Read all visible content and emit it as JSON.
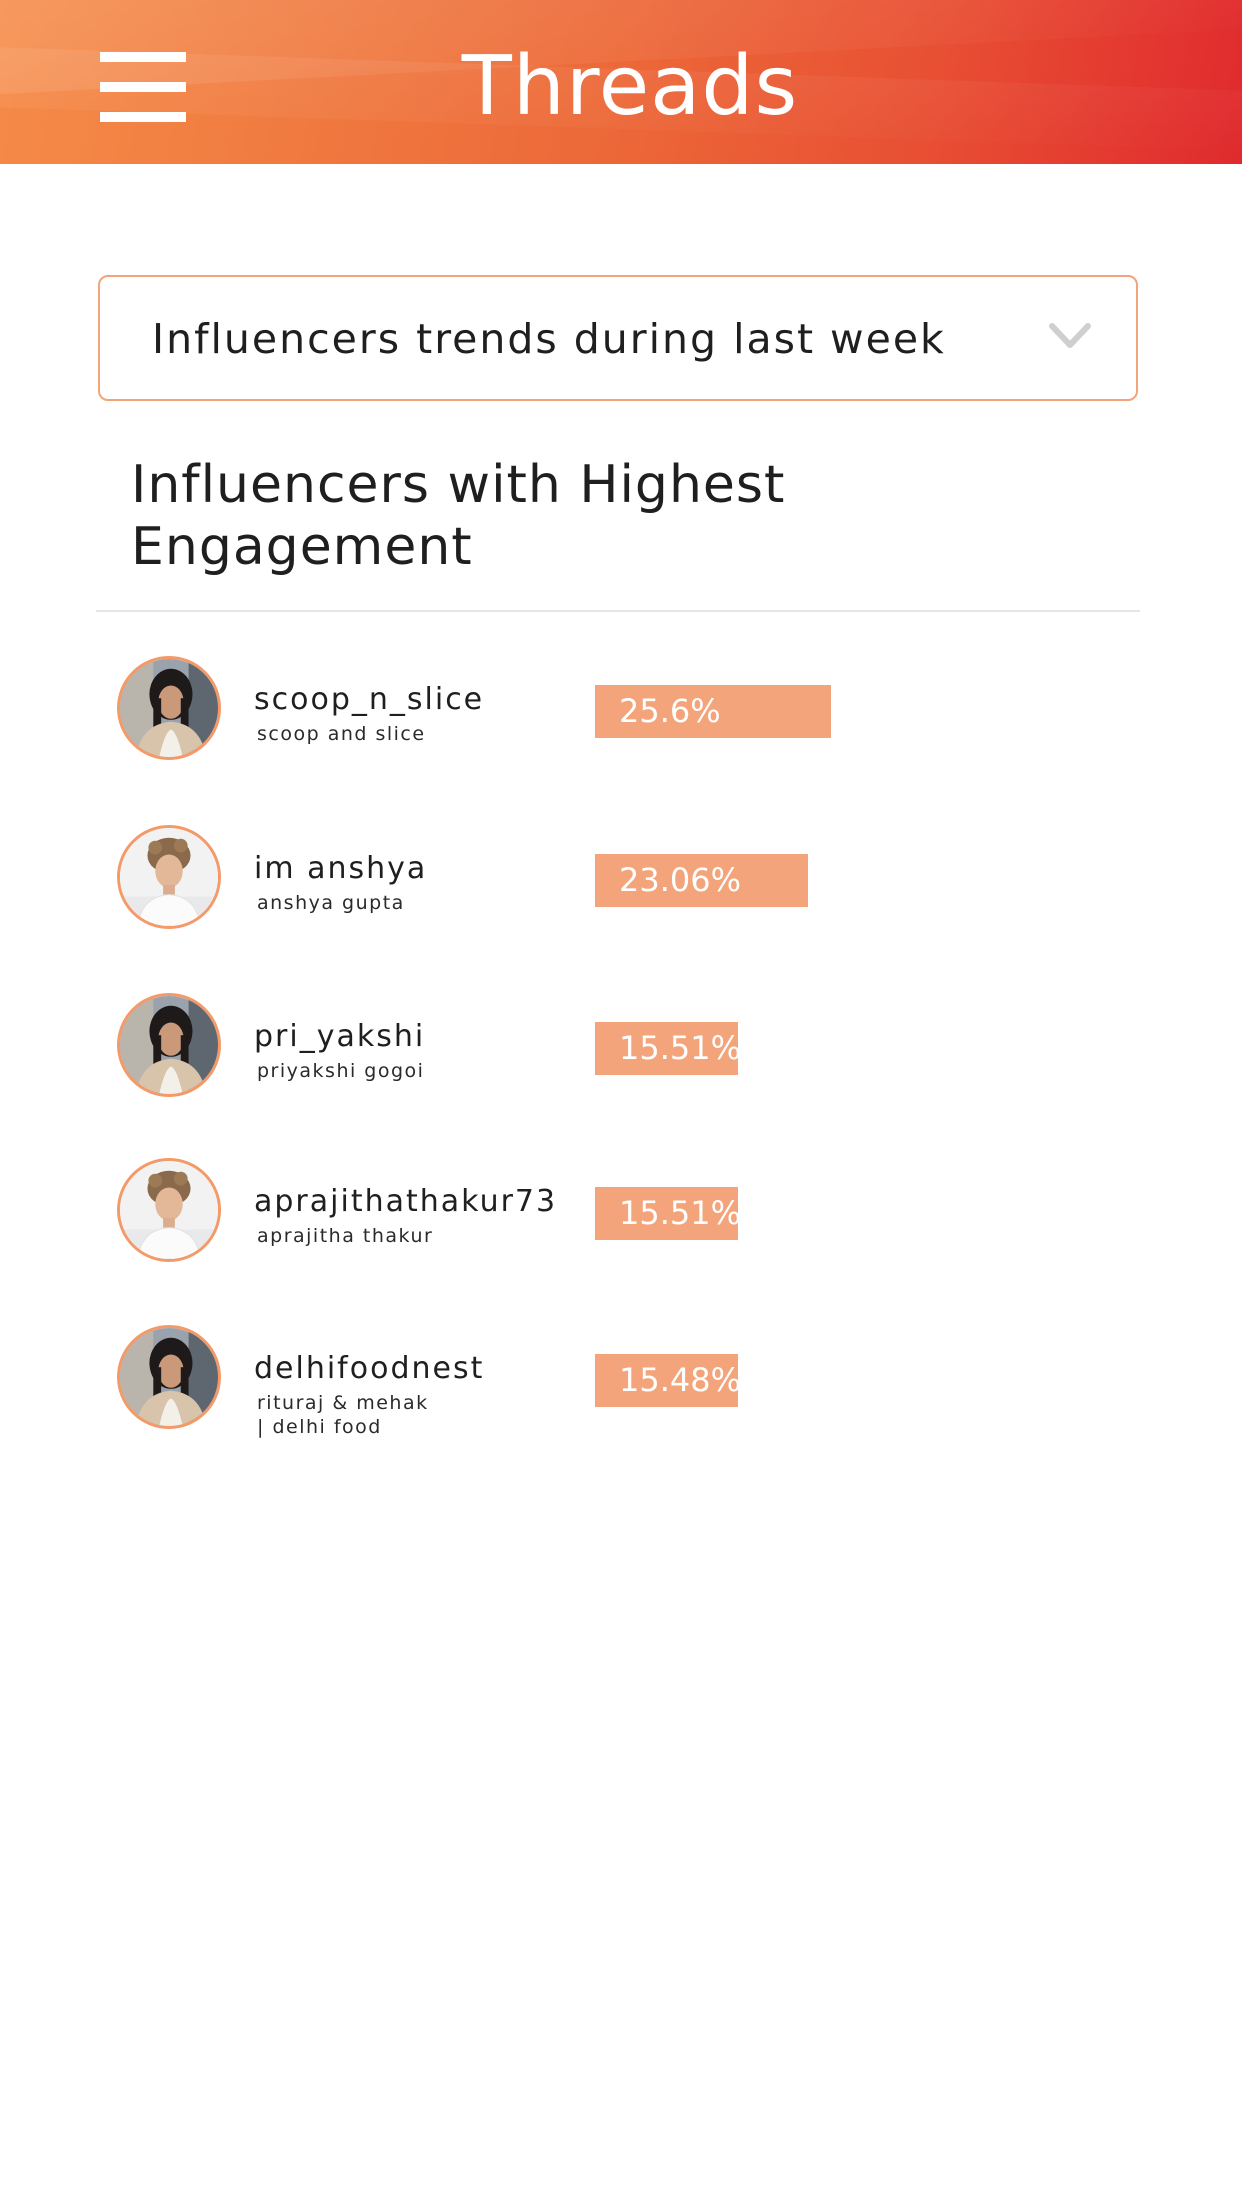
{
  "header": {
    "logo_text": "Threads",
    "menu_icon": "hamburger-menu-icon",
    "brand_color_start": "#f58b48",
    "brand_color_end": "#e02a2e"
  },
  "filter": {
    "selected": "Influencers trends during last week",
    "chevron_icon": "chevron-down-icon"
  },
  "section": {
    "title": "Influencers with Highest Engagement"
  },
  "accent_color": "#f3a47a",
  "chart_data": {
    "type": "bar",
    "categories": [
      "scoop_n_slice",
      "im anshya",
      "pri_yakshi",
      "aprajithathakur73",
      "delhifoodnest"
    ],
    "values": [
      25.6,
      23.06,
      15.51,
      15.51,
      15.48
    ]
  },
  "influencers": [
    {
      "handle": "scoop_n_slice",
      "name": "scoop and slice",
      "engagement": 25.6,
      "engagement_label": "25.6%",
      "avatar": "dark-hair"
    },
    {
      "handle": "im anshya",
      "name": "anshya gupta",
      "engagement": 23.06,
      "engagement_label": "23.06%",
      "avatar": "curly-hair"
    },
    {
      "handle": "pri_yakshi",
      "name": "priyakshi gogoi",
      "engagement": 15.51,
      "engagement_label": "15.51%",
      "avatar": "dark-hair"
    },
    {
      "handle": "aprajithathakur73",
      "name": "aprajitha thakur",
      "engagement": 15.51,
      "engagement_label": "15.51%",
      "avatar": "curly-hair"
    },
    {
      "handle": "delhifoodnest",
      "name": "rituraj & mehak | delhi food",
      "engagement": 15.48,
      "engagement_label": "15.48%",
      "avatar": "dark-hair"
    }
  ]
}
